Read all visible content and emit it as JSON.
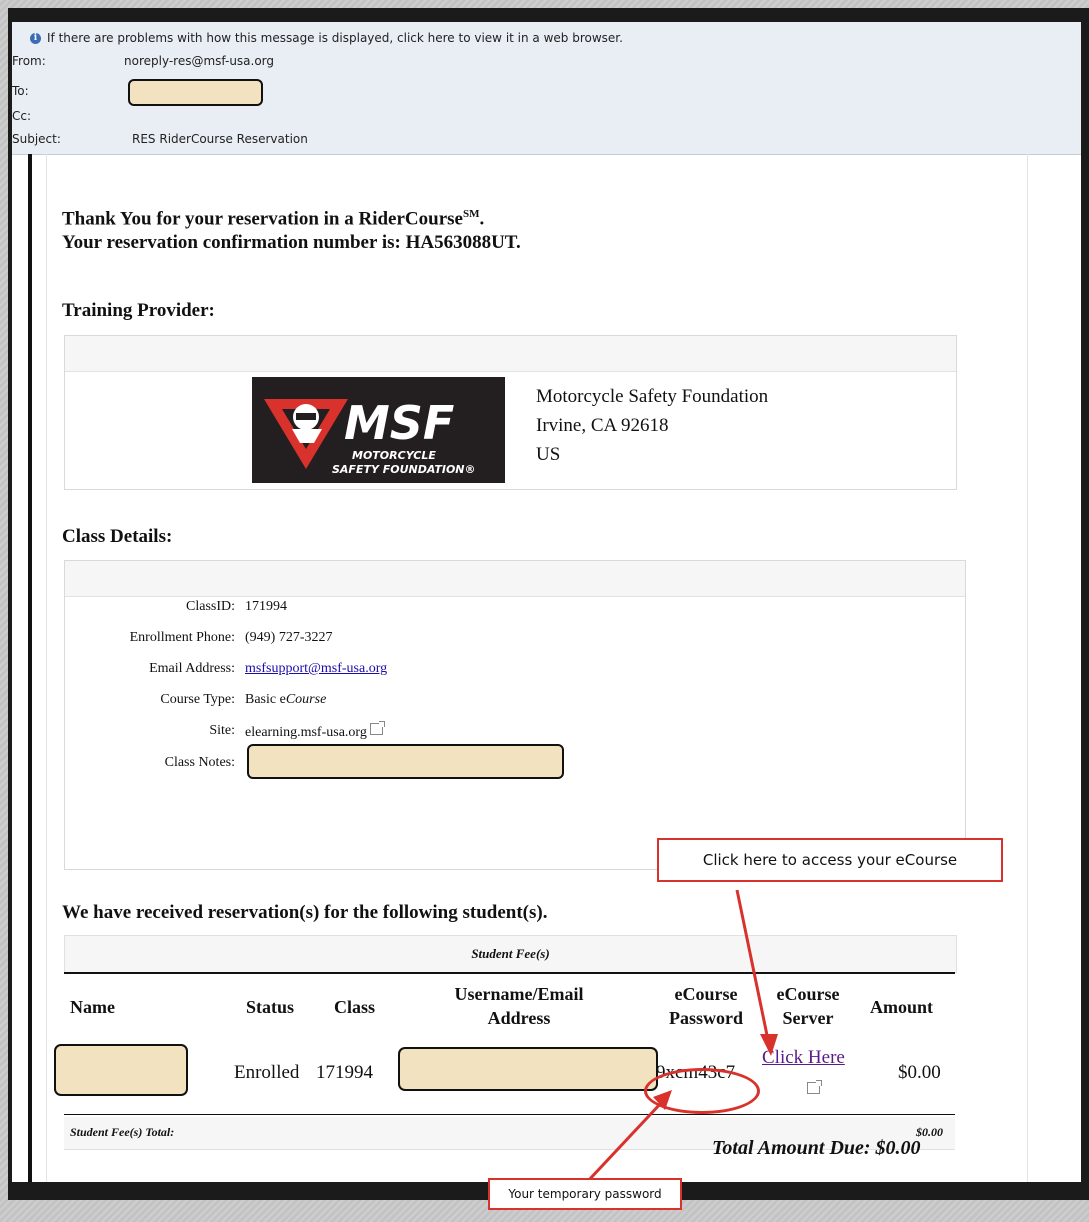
{
  "header": {
    "info_text": "If there are problems with how this message is displayed, click here to view it in a web browser.",
    "from_label": "From:",
    "from_value": "noreply-res@msf-usa.org",
    "to_label": "To:",
    "cc_label": "Cc:",
    "subject_label": "Subject:",
    "subject_value": "RES RiderCourse Reservation"
  },
  "intro": {
    "line1": "Thank You for your reservation in a RiderCourse",
    "sup": "SM",
    "line1_end": ".",
    "line2": "Your reservation confirmation number is: HA563088UT."
  },
  "provider": {
    "heading": "Training Provider:",
    "logo_text": "MSF",
    "logo_sub1": "MOTORCYCLE",
    "logo_sub2": "SAFETY FOUNDATION®",
    "name": "Motorcycle Safety Foundation",
    "city": "Irvine, CA 92618",
    "country": "US"
  },
  "class_details": {
    "heading": "Class Details:",
    "rows": [
      {
        "label": "ClassID:",
        "value": "171994"
      },
      {
        "label": "Enrollment Phone:",
        "value": "(949) 727-3227"
      },
      {
        "label": "Email Address:",
        "value": "msfsupport@msf-usa.org"
      },
      {
        "label": "Course Type:",
        "value": "Basic e",
        "value_italic": "Course"
      },
      {
        "label": "Site:",
        "value": "elearning.msf-usa.org"
      },
      {
        "label": "Class Notes:",
        "value": ""
      }
    ]
  },
  "students": {
    "heading": "We have received reservation(s) for the following student(s).",
    "caption": "Student Fee(s)",
    "columns": {
      "name": "Name",
      "status": "Status",
      "class": "Class",
      "username_1": "Username/Email",
      "username_2": "Address",
      "password_1": "eCourse",
      "password_2": "Password",
      "server_1": "eCourse",
      "server_2": "Server",
      "amount": "Amount"
    },
    "row": {
      "status": "Enrolled",
      "class": "171994",
      "password": "9xcm43c7",
      "server_link": "Click Here",
      "amount": "$0.00"
    },
    "total_label": "Student Fee(s) Total:",
    "total_value": "$0.00",
    "grand_total": "Total Amount Due: $0.00"
  },
  "annotations": {
    "access_callout": "Click here to access your eCourse",
    "password_callout": "Your temporary password",
    "accent": "#d9312b"
  }
}
